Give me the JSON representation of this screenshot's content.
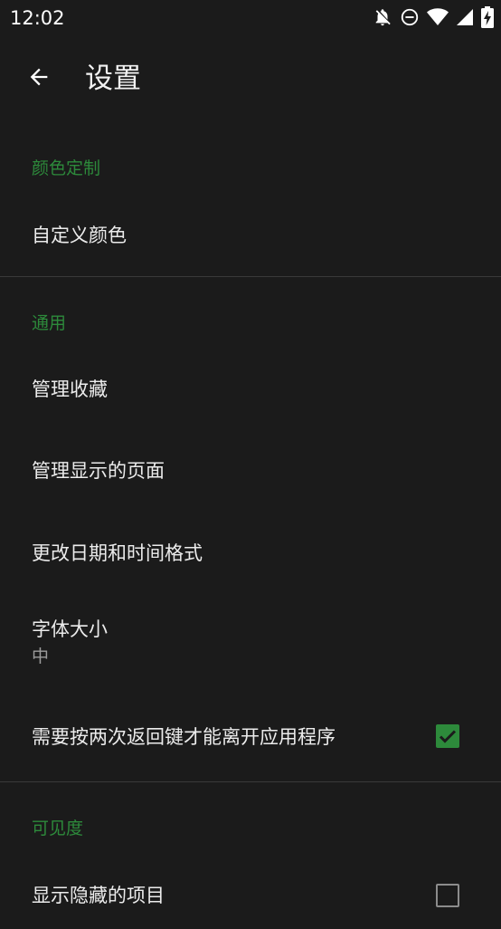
{
  "status_bar": {
    "time": "12:02",
    "icons": [
      "notifications-off-icon",
      "do-not-disturb-icon",
      "wifi-icon",
      "cellular-signal-icon",
      "battery-charging-icon"
    ]
  },
  "toolbar": {
    "title": "设置",
    "back_icon": "arrow-back-icon"
  },
  "sections": {
    "color": {
      "header": "颜色定制",
      "items": {
        "custom_color": {
          "title": "自定义颜色"
        }
      }
    },
    "general": {
      "header": "通用",
      "items": {
        "manage_favorites": {
          "title": "管理收藏"
        },
        "manage_pages": {
          "title": "管理显示的页面"
        },
        "date_time_format": {
          "title": "更改日期和时间格式"
        },
        "font_size": {
          "title": "字体大小",
          "summary": "中"
        },
        "press_back_twice": {
          "title": "需要按两次返回键才能离开应用程序",
          "checked": true
        }
      }
    },
    "visibility": {
      "header": "可见度",
      "items": {
        "show_hidden": {
          "title": "显示隐藏的项目",
          "checked": false
        }
      }
    }
  },
  "colors": {
    "background": "#1b1b1b",
    "accent": "#2d8a3b",
    "text_primary": "#ececec",
    "text_secondary": "#9c9c9c",
    "divider": "#3a3a3a"
  }
}
